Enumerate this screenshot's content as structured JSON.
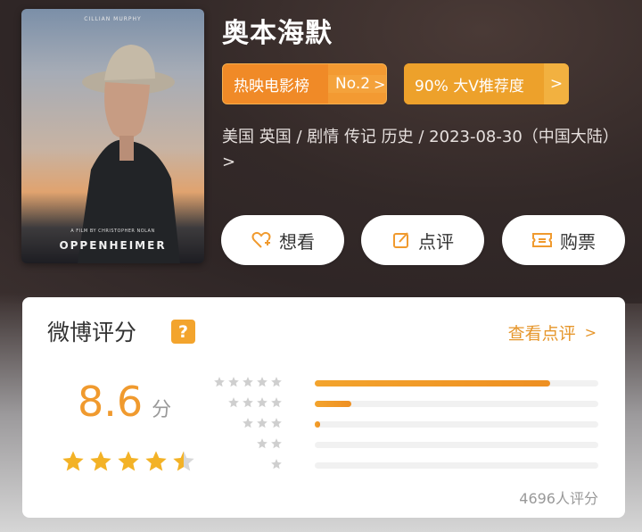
{
  "movie": {
    "title": "奥本海默",
    "poster_top": "CILLIAN MURPHY",
    "poster_credit": "A FILM BY CHRISTOPHER NOLAN",
    "poster_title": "OPPENHEIMER",
    "meta": "美国 英国 / 剧情 传记 历史 / 2023-08-30（中国大陆） >"
  },
  "tags": {
    "rank_label": "热映电影榜",
    "rank_value": "No.2",
    "rec_label": "90% 大V推荐度",
    "chevron": ">"
  },
  "actions": {
    "want": "想看",
    "review": "点评",
    "ticket": "购票"
  },
  "rating": {
    "title": "微博评分",
    "help": "?",
    "view_reviews": "查看点评",
    "view_chevron": ">",
    "score": "8.6",
    "score_unit": "分",
    "stars_filled": 4.5,
    "count_text": "4696人评分",
    "distribution": [
      {
        "stars": 5,
        "fraction": 0.83
      },
      {
        "stars": 4,
        "fraction": 0.13
      },
      {
        "stars": 3,
        "fraction": 0.02
      },
      {
        "stars": 2,
        "fraction": 0.0
      },
      {
        "stars": 1,
        "fraction": 0.0
      }
    ]
  },
  "colors": {
    "accent": "#f09a2e",
    "star": "#f3b226",
    "star_empty": "#d8d8d8"
  }
}
